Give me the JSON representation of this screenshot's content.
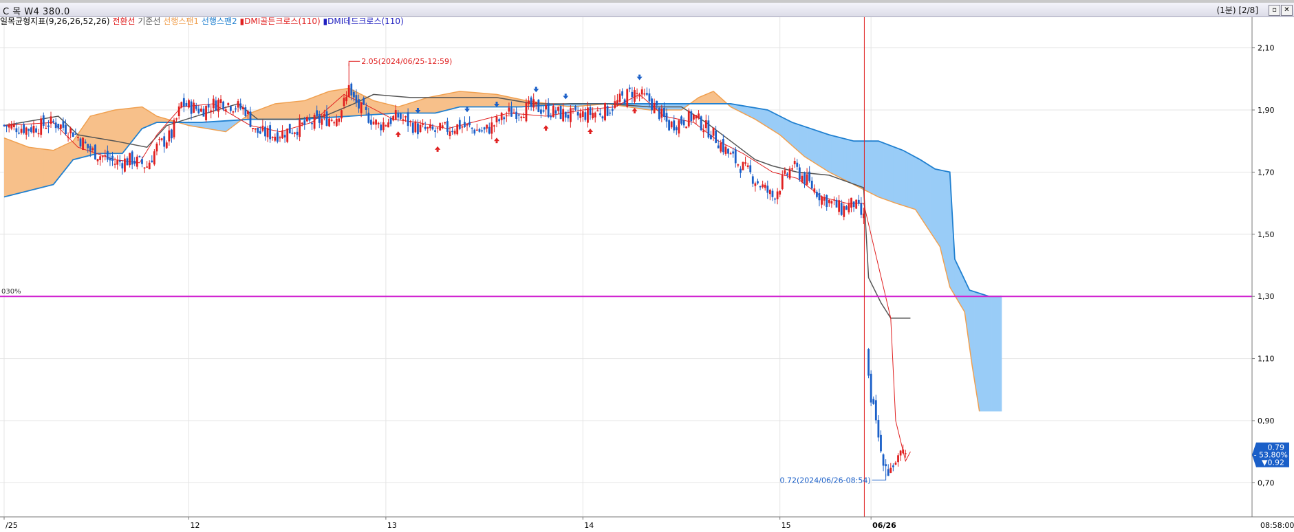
{
  "window": {
    "title": "C 목 W4 380.0",
    "page_indicator": "(1분) [2/8]",
    "restore_icon": "restore-icon",
    "close_icon": "close-icon"
  },
  "legend": [
    {
      "label": "일목균형지표(9,26,26,52,26)",
      "color": "#000000"
    },
    {
      "label": "전환선",
      "color": "#e02020"
    },
    {
      "label": "기준선",
      "color": "#555555"
    },
    {
      "label": "선행스팬1",
      "color": "#f0a050"
    },
    {
      "label": "선행스팬2",
      "color": "#2080d0"
    },
    {
      "label": "DMI골든크로스(110)",
      "color": "#e02020",
      "icon": "marker-icon"
    },
    {
      "label": "DMI데드크로스(110)",
      "color": "#2020c0",
      "icon": "marker-icon"
    }
  ],
  "colors": {
    "up": "#e02020",
    "down": "#1a5fc8",
    "tenkan": "#e02020",
    "kijun": "#555555",
    "span1": "#f0a050",
    "span2": "#2080d0",
    "cloud_bull": "#f7c08a",
    "cloud_bear": "#99ccf7",
    "hline": "#d020d0",
    "vline": "#e02020",
    "grid": "#e4e4e4"
  },
  "chart_data": {
    "type": "candlestick",
    "ylim": [
      0.65,
      2.15
    ],
    "y_ticks": [
      "2,10",
      "1,90",
      "1,70",
      "1,50",
      "1,30",
      "1,10",
      "0,90",
      "0,70"
    ],
    "y_tick_values": [
      2.1,
      1.9,
      1.7,
      1.5,
      1.3,
      1.1,
      0.9,
      0.7
    ],
    "x_ticks": [
      "/25",
      "12",
      "13",
      "14",
      "15",
      "06/26"
    ],
    "x_tick_index": [
      0,
      75,
      155,
      235,
      315,
      352
    ],
    "last_time_label": "08:58:00",
    "n_bars": 365,
    "horizontal_line": {
      "label": "030%",
      "value": 1.3
    },
    "vertical_line_index": 349,
    "annotations": {
      "high": {
        "label": "2.05(2024/06/25-12:59)",
        "value": 2.05,
        "index": 140
      },
      "low": {
        "label": "0.72(2024/06/26-08:54)",
        "value": 0.72,
        "index": 358
      }
    },
    "price_box": {
      "price": "0.79",
      "change_pct": "- 53.80%",
      "change": "▼0.92",
      "value": 0.79
    },
    "close_path": [
      [
        0,
        1.85
      ],
      [
        10,
        1.84
      ],
      [
        20,
        1.86
      ],
      [
        28,
        1.83
      ],
      [
        35,
        1.77
      ],
      [
        45,
        1.73
      ],
      [
        52,
        1.74
      ],
      [
        58,
        1.72
      ],
      [
        62,
        1.78
      ],
      [
        68,
        1.82
      ],
      [
        72,
        1.92
      ],
      [
        80,
        1.9
      ],
      [
        88,
        1.93
      ],
      [
        98,
        1.9
      ],
      [
        102,
        1.83
      ],
      [
        110,
        1.82
      ],
      [
        118,
        1.84
      ],
      [
        125,
        1.86
      ],
      [
        135,
        1.88
      ],
      [
        140,
        1.95
      ],
      [
        145,
        1.9
      ],
      [
        152,
        1.85
      ],
      [
        160,
        1.88
      ],
      [
        168,
        1.84
      ],
      [
        175,
        1.83
      ],
      [
        185,
        1.85
      ],
      [
        195,
        1.83
      ],
      [
        205,
        1.89
      ],
      [
        215,
        1.91
      ],
      [
        225,
        1.89
      ],
      [
        232,
        1.88
      ],
      [
        245,
        1.9
      ],
      [
        255,
        1.96
      ],
      [
        262,
        1.93
      ],
      [
        270,
        1.85
      ],
      [
        280,
        1.88
      ],
      [
        288,
        1.82
      ],
      [
        295,
        1.75
      ],
      [
        302,
        1.7
      ],
      [
        312,
        1.62
      ],
      [
        320,
        1.72
      ],
      [
        332,
        1.62
      ],
      [
        340,
        1.58
      ],
      [
        345,
        1.6
      ],
      [
        349,
        1.55
      ],
      [
        350,
        1.12
      ],
      [
        352,
        0.98
      ],
      [
        356,
        0.8
      ],
      [
        359,
        0.74
      ],
      [
        362,
        0.77
      ],
      [
        366,
        0.79
      ]
    ],
    "high_index": 140,
    "tenkan": [
      [
        0,
        1.85
      ],
      [
        20,
        1.86
      ],
      [
        30,
        1.78
      ],
      [
        45,
        1.74
      ],
      [
        55,
        1.73
      ],
      [
        62,
        1.82
      ],
      [
        72,
        1.91
      ],
      [
        85,
        1.92
      ],
      [
        100,
        1.85
      ],
      [
        112,
        1.83
      ],
      [
        125,
        1.86
      ],
      [
        138,
        1.95
      ],
      [
        146,
        1.92
      ],
      [
        158,
        1.87
      ],
      [
        168,
        1.86
      ],
      [
        180,
        1.84
      ],
      [
        190,
        1.86
      ],
      [
        205,
        1.89
      ],
      [
        220,
        1.88
      ],
      [
        235,
        1.9
      ],
      [
        248,
        1.91
      ],
      [
        258,
        1.95
      ],
      [
        268,
        1.88
      ],
      [
        280,
        1.86
      ],
      [
        290,
        1.8
      ],
      [
        300,
        1.76
      ],
      [
        312,
        1.7
      ],
      [
        322,
        1.68
      ],
      [
        332,
        1.62
      ],
      [
        342,
        1.6
      ],
      [
        349,
        1.6
      ],
      [
        360,
        1.23
      ],
      [
        362,
        0.9
      ],
      [
        366,
        0.77
      ],
      [
        368,
        0.8
      ]
    ],
    "kijun": [
      [
        0,
        1.85
      ],
      [
        22,
        1.88
      ],
      [
        30,
        1.82
      ],
      [
        45,
        1.8
      ],
      [
        58,
        1.78
      ],
      [
        66,
        1.85
      ],
      [
        78,
        1.88
      ],
      [
        95,
        1.92
      ],
      [
        103,
        1.87
      ],
      [
        118,
        1.87
      ],
      [
        130,
        1.88
      ],
      [
        142,
        1.92
      ],
      [
        150,
        1.95
      ],
      [
        165,
        1.94
      ],
      [
        200,
        1.94
      ],
      [
        215,
        1.92
      ],
      [
        245,
        1.92
      ],
      [
        262,
        1.91
      ],
      [
        275,
        1.91
      ],
      [
        285,
        1.86
      ],
      [
        295,
        1.8
      ],
      [
        305,
        1.74
      ],
      [
        312,
        1.72
      ],
      [
        322,
        1.7
      ],
      [
        335,
        1.69
      ],
      [
        349,
        1.65
      ],
      [
        351,
        1.36
      ],
      [
        356,
        1.28
      ],
      [
        360,
        1.23
      ],
      [
        368,
        1.23
      ]
    ],
    "span1": [
      [
        0,
        1.81
      ],
      [
        10,
        1.78
      ],
      [
        20,
        1.77
      ],
      [
        28,
        1.8
      ],
      [
        35,
        1.88
      ],
      [
        45,
        1.9
      ],
      [
        56,
        1.91
      ],
      [
        62,
        1.88
      ],
      [
        75,
        1.85
      ],
      [
        90,
        1.83
      ],
      [
        100,
        1.89
      ],
      [
        110,
        1.92
      ],
      [
        122,
        1.93
      ],
      [
        132,
        1.96
      ],
      [
        140,
        1.97
      ],
      [
        150,
        1.93
      ],
      [
        160,
        1.91
      ],
      [
        172,
        1.94
      ],
      [
        185,
        1.96
      ],
      [
        200,
        1.95
      ],
      [
        212,
        1.93
      ],
      [
        230,
        1.91
      ],
      [
        245,
        1.92
      ],
      [
        262,
        1.9
      ],
      [
        275,
        1.9
      ],
      [
        282,
        1.94
      ],
      [
        288,
        1.96
      ],
      [
        295,
        1.91
      ],
      [
        305,
        1.87
      ],
      [
        315,
        1.82
      ],
      [
        325,
        1.75
      ],
      [
        335,
        1.7
      ],
      [
        345,
        1.66
      ],
      [
        355,
        1.62
      ],
      [
        362,
        1.6
      ],
      [
        370,
        1.58
      ],
      [
        380,
        1.46
      ],
      [
        384,
        1.33
      ],
      [
        390,
        1.25
      ],
      [
        393,
        1.08
      ],
      [
        396,
        0.93
      ]
    ],
    "span2": [
      [
        0,
        1.62
      ],
      [
        10,
        1.64
      ],
      [
        20,
        1.66
      ],
      [
        28,
        1.74
      ],
      [
        38,
        1.76
      ],
      [
        48,
        1.76
      ],
      [
        56,
        1.84
      ],
      [
        62,
        1.86
      ],
      [
        80,
        1.86
      ],
      [
        100,
        1.87
      ],
      [
        120,
        1.87
      ],
      [
        140,
        1.88
      ],
      [
        160,
        1.89
      ],
      [
        175,
        1.89
      ],
      [
        185,
        1.91
      ],
      [
        210,
        1.91
      ],
      [
        230,
        1.92
      ],
      [
        262,
        1.92
      ],
      [
        275,
        1.92
      ],
      [
        295,
        1.92
      ],
      [
        310,
        1.9
      ],
      [
        320,
        1.86
      ],
      [
        335,
        1.82
      ],
      [
        345,
        1.8
      ],
      [
        355,
        1.8
      ],
      [
        365,
        1.77
      ],
      [
        372,
        1.74
      ],
      [
        378,
        1.71
      ],
      [
        384,
        1.7
      ],
      [
        386,
        1.42
      ],
      [
        392,
        1.32
      ],
      [
        400,
        1.3
      ],
      [
        405,
        1.3
      ]
    ],
    "golden_cross_index": [
      160,
      176,
      200,
      220,
      238,
      256
    ],
    "dead_cross_index": [
      168,
      188,
      200,
      216,
      228,
      258
    ]
  }
}
